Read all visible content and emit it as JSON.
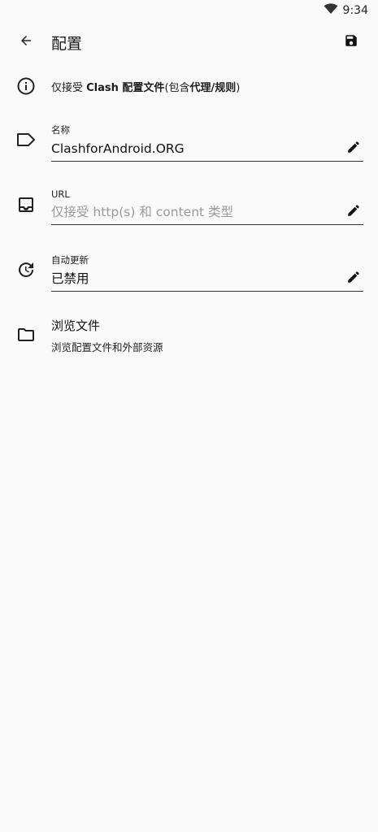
{
  "status": {
    "time": "9:34",
    "icons": [
      "wifi-icon"
    ]
  },
  "appbar": {
    "title": "配置",
    "back_icon": "arrow-back-icon",
    "save_icon": "save-icon"
  },
  "info": {
    "icon": "info-icon",
    "prefix": "仅接受 ",
    "bold1": "Clash 配置文件",
    "mid": "(包含",
    "bold2": "代理/规则",
    "suffix": ")"
  },
  "fields": {
    "name": {
      "icon": "label-icon",
      "label": "名称",
      "value": "ClashforAndroid.ORG",
      "edit_icon": "edit-icon"
    },
    "url": {
      "icon": "inbox-icon",
      "label": "URL",
      "placeholder": "仅接受 http(s) 和 content 类型",
      "value": "",
      "edit_icon": "edit-icon"
    },
    "auto_update": {
      "icon": "update-icon",
      "label": "自动更新",
      "value": "已禁用",
      "edit_icon": "edit-icon"
    }
  },
  "browse": {
    "icon": "folder-icon",
    "title": "浏览文件",
    "subtitle": "浏览配置文件和外部资源"
  }
}
